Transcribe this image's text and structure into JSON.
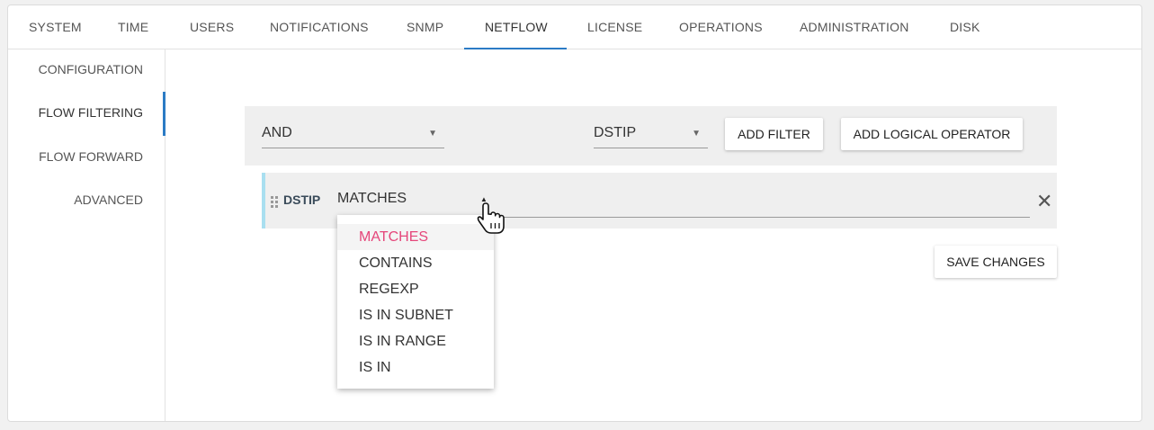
{
  "tabs": [
    {
      "label": "SYSTEM"
    },
    {
      "label": "TIME"
    },
    {
      "label": "USERS"
    },
    {
      "label": "NOTIFICATIONS"
    },
    {
      "label": "SNMP"
    },
    {
      "label": "NETFLOW"
    },
    {
      "label": "LICENSE"
    },
    {
      "label": "OPERATIONS"
    },
    {
      "label": "ADMINISTRATION"
    },
    {
      "label": "DISK"
    }
  ],
  "active_tab": "NETFLOW",
  "sidebar": {
    "items": [
      {
        "label": "CONFIGURATION"
      },
      {
        "label": "FLOW FILTERING"
      },
      {
        "label": "FLOW FORWARD"
      },
      {
        "label": "ADVANCED"
      }
    ],
    "active": "FLOW FILTERING"
  },
  "filter_bar": {
    "logical_select_value": "AND",
    "field_select_value": "DSTIP",
    "add_filter_label": "ADD FILTER",
    "add_logical_operator_label": "ADD LOGICAL OPERATOR"
  },
  "rule": {
    "field": "DSTIP",
    "operator": "MATCHES",
    "value": ""
  },
  "operator_dropdown": {
    "options": [
      "MATCHES",
      "CONTAINS",
      "REGEXP",
      "IS IN SUBNET",
      "IS IN RANGE",
      "IS IN"
    ],
    "selected": "MATCHES"
  },
  "save_changes_label": "SAVE CHANGES",
  "colors": {
    "accent": "#2b7bc5",
    "selected_option": "#e5467a",
    "rule_border": "#a9dff0"
  },
  "icons": {
    "caret": "triangle-down",
    "remove": "close-x",
    "drag": "drag-handle",
    "cursor": "hand-pointer"
  }
}
